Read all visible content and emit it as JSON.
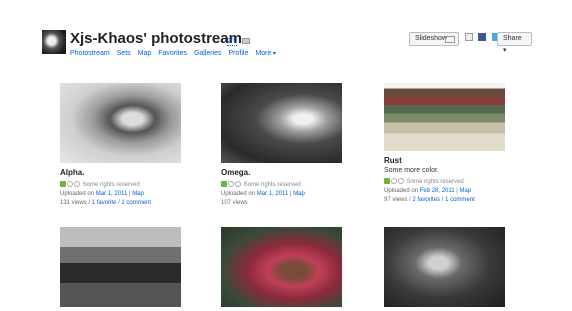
{
  "header": {
    "title": "Xjs-Khaos' photostream",
    "pro_label": "pro",
    "nav": [
      "Photostream",
      "Sets",
      "Map",
      "Favorites",
      "Galleries",
      "Profile",
      "More"
    ],
    "slideshow_label": "Slideshow",
    "share_label": "Share"
  },
  "photos": [
    {
      "title": "Alpha.",
      "description": "",
      "rights": "Some rights reserved",
      "uploaded_prefix": "Uploaded on",
      "date": "Mar 1, 2011",
      "map": "Map",
      "views": "131 views",
      "favorites": "1 favorite",
      "comments": "1 comment"
    },
    {
      "title": "Omega.",
      "description": "",
      "rights": "Some rights reserved",
      "uploaded_prefix": "Uploaded on",
      "date": "Mar 1, 2011",
      "map": "Map",
      "views": "107 views",
      "favorites": "",
      "comments": ""
    },
    {
      "title": "Rust",
      "description": "Some more color.",
      "rights": "Some rights reserved",
      "uploaded_prefix": "Uploaded on",
      "date": "Feb 28, 2011",
      "map": "Map",
      "views": "97 views",
      "favorites": "2 favorites",
      "comments": "1 comment"
    }
  ],
  "separator": "|",
  "slash": "/"
}
